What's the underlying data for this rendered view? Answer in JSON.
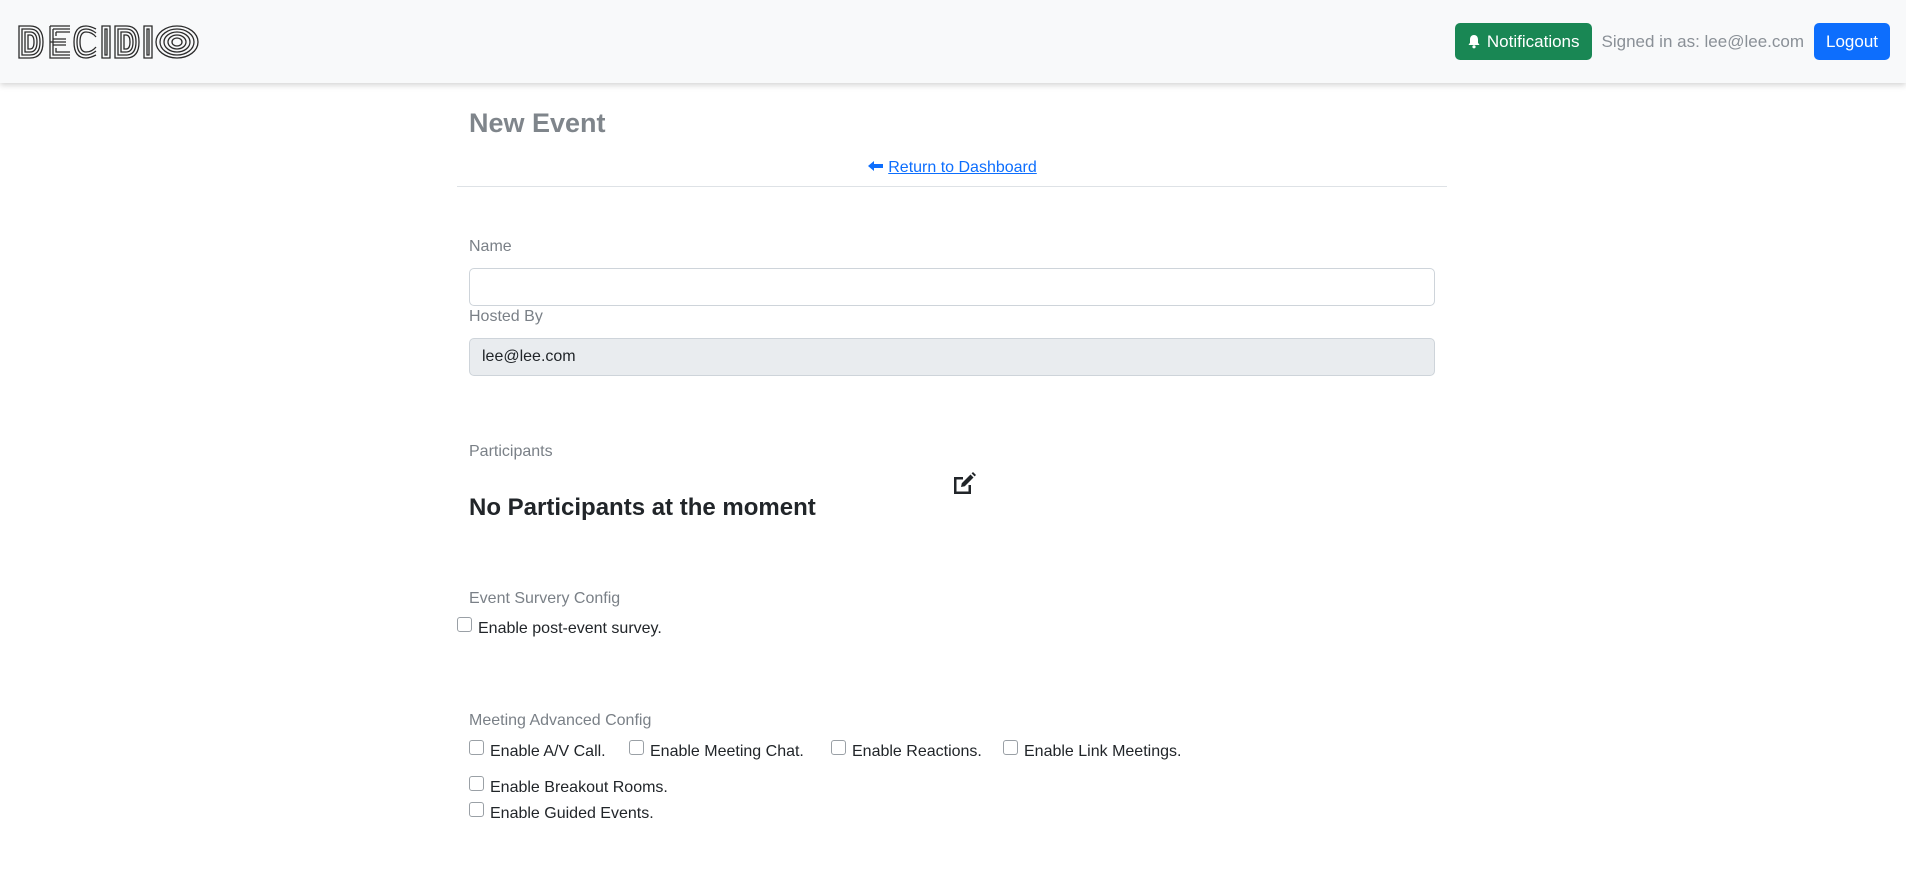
{
  "navbar": {
    "logo_text": "DECIDIO",
    "notifications_label": "Notifications",
    "notifications_icon": "bell-icon",
    "signed_in_text": "Signed in as: lee@lee.com",
    "logout_label": "Logout"
  },
  "page": {
    "title": "New Event",
    "return_link": "Return to Dashboard",
    "return_icon": "arrow-left-icon"
  },
  "form": {
    "name_label": "Name",
    "name_value": "",
    "hosted_by_label": "Hosted By",
    "hosted_by_value": "lee@lee.com",
    "participants_label": "Participants",
    "participants_empty": "No Participants at the moment",
    "participants_edit_icon": "edit-icon",
    "survey_section_label": "Event Survery Config",
    "survey_options": [
      {
        "label": "Enable post-event survey.",
        "checked": false
      }
    ],
    "advanced_section_label": "Meeting Advanced Config",
    "advanced_options": [
      {
        "label": "Enable A/V Call.",
        "checked": false
      },
      {
        "label": "Enable Meeting Chat.",
        "checked": false
      },
      {
        "label": "Enable Reactions.",
        "checked": false
      },
      {
        "label": "Enable Link Meetings.",
        "checked": false
      },
      {
        "label": "Enable Breakout Rooms.",
        "checked": false
      },
      {
        "label": "Enable Guided Events.",
        "checked": false
      }
    ]
  },
  "colors": {
    "success": "#198754",
    "primary": "#0d6efd",
    "navbar_bg": "#f8f9fa"
  }
}
